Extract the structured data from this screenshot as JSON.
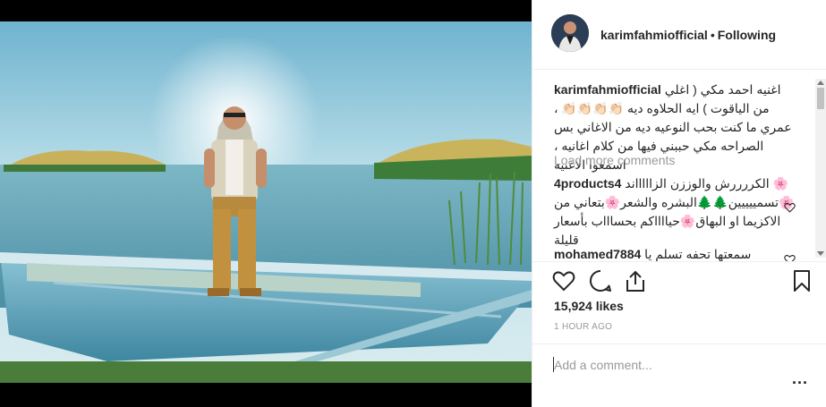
{
  "post": {
    "username": "karimfahmiofficial",
    "separator": "•",
    "follow_status": "Following"
  },
  "caption": {
    "username": "karimfahmiofficial",
    "text": "اغنيه احمد مكي ( اغلي من الياقوت ) ايه الحلاوه ديه 👏🏻👏🏻👏🏻👏🏻 ، عمري ما كنت بحب النوعيه ديه من الاغاني بس الصراحه مكي حببني فيها من كلام اغانيه ، اسمعوا الاغنيه"
  },
  "load_more_label": "Load more comments",
  "comments": [
    {
      "username": "4products4",
      "text": "🌸 الكررررش والوززن الزاااااند 🌸تسمييييين🌲🌲البشره والشعر🌸بتعاني من الاكزيما او البهاق🌸حيااااكم بحساااب بأسعار قليلة"
    },
    {
      "username": "mohamed7884",
      "text": "سمعتها تحفه تسلم يا"
    }
  ],
  "icons": {
    "like": "heart-icon",
    "comment": "comment-bubble-icon",
    "share": "share-icon",
    "save": "bookmark-icon",
    "options": "more-options-icon"
  },
  "likes_text": "15,924 likes",
  "timestamp": "1 HOUR AGO",
  "add_comment_placeholder": "Add a comment...",
  "options_label": "...",
  "colors": {
    "text": "#262626",
    "muted": "#999999",
    "border": "#efefef"
  }
}
